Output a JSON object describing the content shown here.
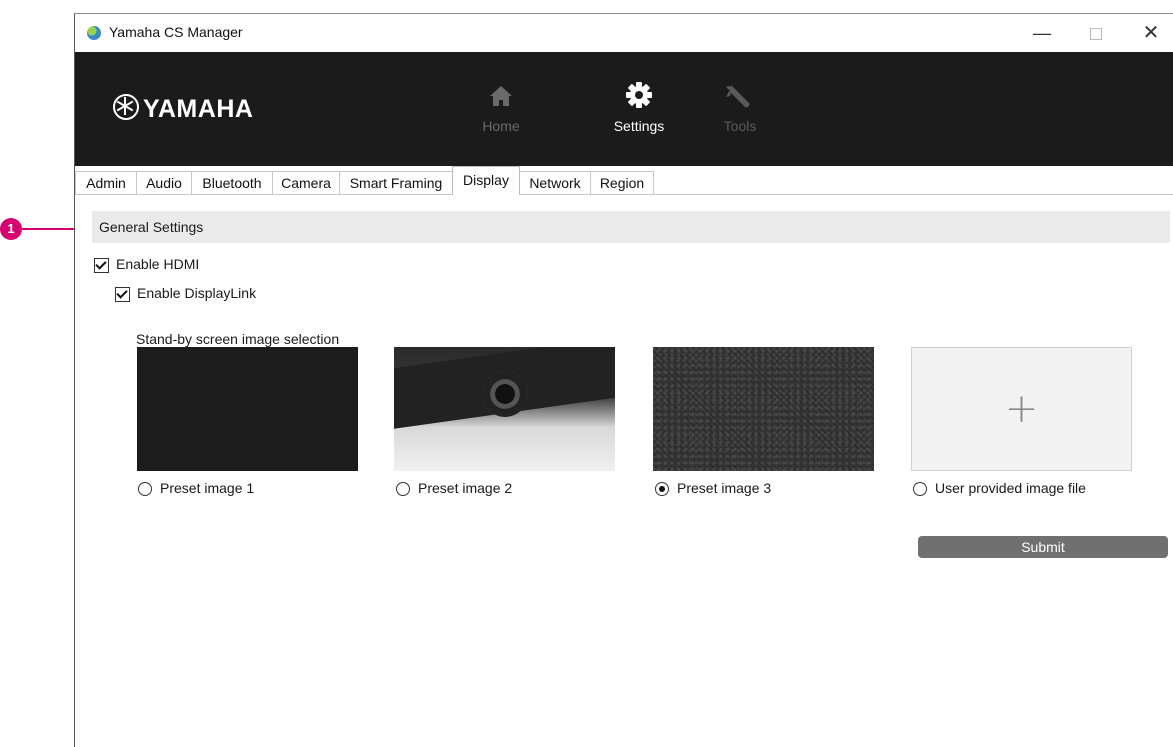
{
  "callout": {
    "number": "1"
  },
  "window": {
    "title": "Yamaha CS Manager",
    "controls": {
      "minimize": "—",
      "close": "✕"
    }
  },
  "header": {
    "logo": "YAMAHA",
    "nav": [
      {
        "label": "Home",
        "icon": "home-icon",
        "active": false
      },
      {
        "label": "Settings",
        "icon": "gear-icon",
        "active": true
      },
      {
        "label": "Tools",
        "icon": "wrench-icon",
        "active": false
      }
    ]
  },
  "tabs": [
    {
      "label": "Admin"
    },
    {
      "label": "Audio"
    },
    {
      "label": "Bluetooth"
    },
    {
      "label": "Camera"
    },
    {
      "label": "Smart Framing"
    },
    {
      "label": "Display",
      "active": true
    },
    {
      "label": "Network"
    },
    {
      "label": "Region"
    }
  ],
  "general": {
    "section_title": "General Settings",
    "enable_hdmi": {
      "label": "Enable HDMI",
      "checked": true
    },
    "enable_displaylink": {
      "label": "Enable DisplayLink",
      "checked": true
    },
    "standby_label": "Stand-by screen image selection",
    "images": [
      {
        "label": "Preset image 1",
        "selected": false
      },
      {
        "label": "Preset image 2",
        "selected": false
      },
      {
        "label": "Preset image 3",
        "selected": true
      },
      {
        "label": "User provided image file",
        "selected": false,
        "placeholder": "+"
      }
    ],
    "submit_label": "Submit"
  },
  "colors": {
    "callout": "#d6006f",
    "header_bg": "#1b1b1b",
    "submit_bg": "#707070"
  }
}
